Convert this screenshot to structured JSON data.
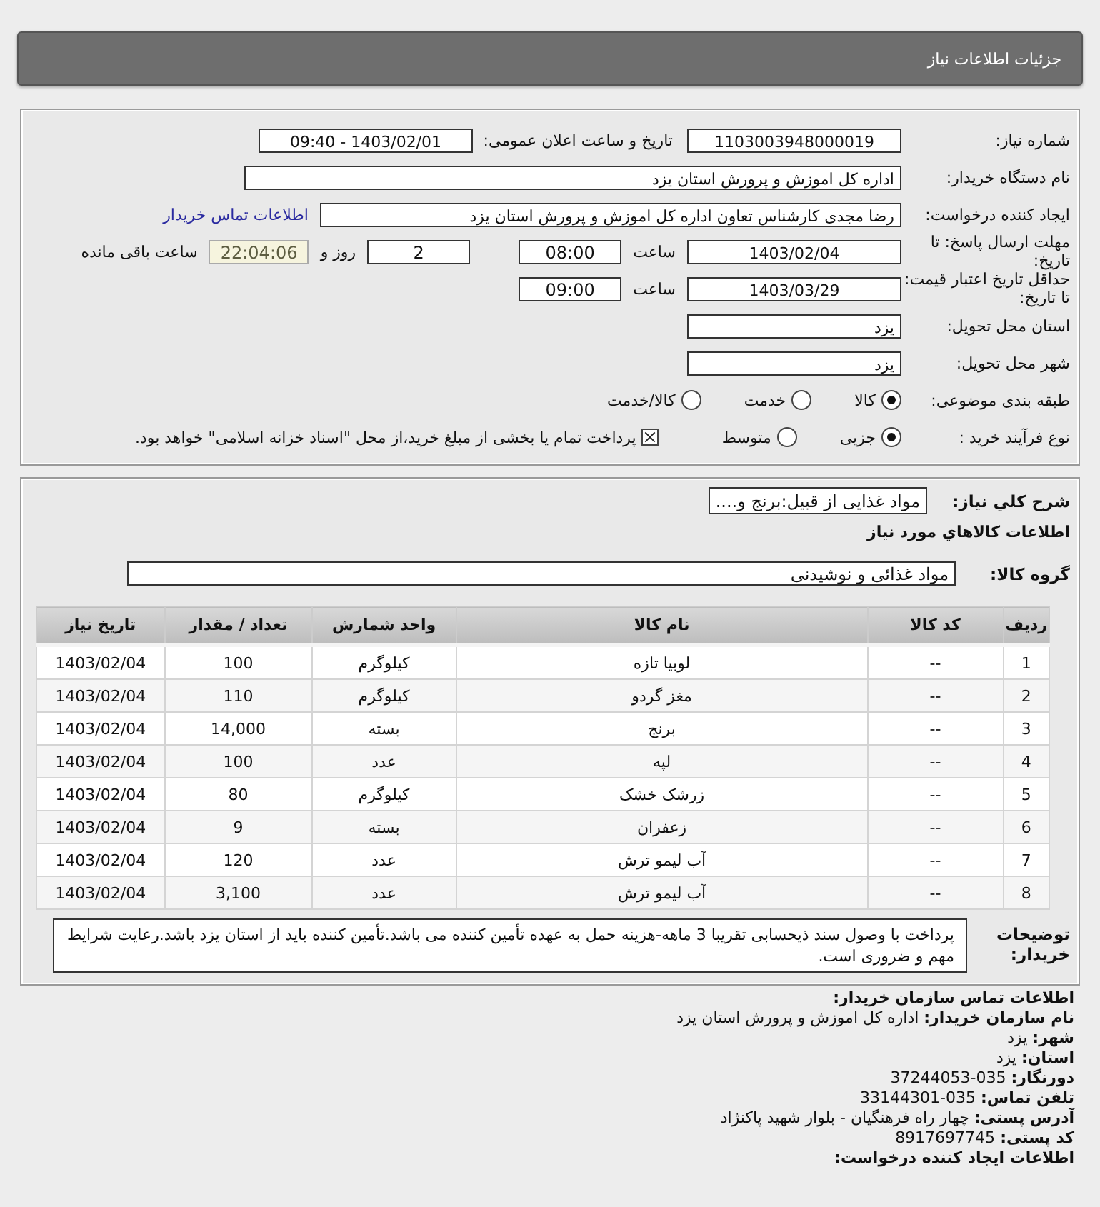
{
  "header": {
    "title": "جزئیات اطلاعات نیاز"
  },
  "details": [
    {
      "label": "شماره نیاز:",
      "items": [
        {
          "kind": "field",
          "value": "1103003948000019"
        },
        {
          "kind": "text",
          "value": "تاریخ و ساعت اعلان عمومی:"
        },
        {
          "kind": "field",
          "value": "1403/02/01 - 09:40"
        }
      ]
    },
    {
      "label": "نام دستگاه خریدار:",
      "items": [
        {
          "kind": "wide",
          "value": "اداره کل اموزش و پرورش استان یزد"
        }
      ]
    },
    {
      "label": "ایجاد کننده درخواست:",
      "items": [
        {
          "kind": "long",
          "value": "رضا مجدی کارشناس تعاون اداره کل اموزش و پرورش استان یزد"
        },
        {
          "kind": "link",
          "value": "اطلاعات تماس خریدار"
        }
      ]
    },
    {
      "label": "مهلت ارسال پاسخ: تا تاریخ:",
      "items": [
        {
          "kind": "field",
          "value": "1403/02/04"
        },
        {
          "kind": "text",
          "value": "ساعت"
        },
        {
          "kind": "short",
          "value": "08:00"
        },
        {
          "kind": "short",
          "value": "2"
        },
        {
          "kind": "text",
          "value": "روز و"
        },
        {
          "kind": "timer",
          "value": "22:04:06"
        },
        {
          "kind": "text",
          "value": "ساعت باقی مانده"
        }
      ]
    },
    {
      "label": "حداقل تاریخ اعتبار قیمت: تا تاریخ:",
      "items": [
        {
          "kind": "field",
          "value": "1403/03/29"
        },
        {
          "kind": "text",
          "value": "ساعت"
        },
        {
          "kind": "short",
          "value": "09:00"
        }
      ]
    },
    {
      "label": "استان محل تحویل:",
      "items": [
        {
          "kind": "field",
          "value": "یزد"
        }
      ]
    },
    {
      "label": "شهر محل تحویل:",
      "items": [
        {
          "kind": "field",
          "value": "یزد"
        }
      ]
    },
    {
      "label": "طبقه بندی موضوعی:",
      "items": [
        {
          "kind": "radio",
          "value": "کالا",
          "selected": true
        },
        {
          "kind": "radio",
          "value": "خدمت",
          "selected": false
        },
        {
          "kind": "radio",
          "value": "کالا/خدمت",
          "selected": false
        }
      ]
    },
    {
      "label": "نوع فرآیند خرید :",
      "items": [
        {
          "kind": "radio",
          "value": "جزیی",
          "selected": true
        },
        {
          "kind": "radio",
          "value": "متوسط",
          "selected": false
        },
        {
          "kind": "checkbox",
          "value": "پرداخت تمام یا بخشی از مبلغ خرید،از محل \"اسناد خزانه اسلامی\" خواهد بود.",
          "checked": true
        }
      ]
    }
  ],
  "need": {
    "summary_label": "شرح کلي نياز:",
    "summary": "مواد غذایی از قبیل:برنج و....",
    "goods_heading": "اطلاعات کالاهاي مورد نياز",
    "group_label": "گروه کالا:",
    "group": "مواد غذائی و نوشیدنی"
  },
  "table": {
    "columns": [
      "ردیف",
      "کد کالا",
      "نام کالا",
      "واحد شمارش",
      "تعداد / مقدار",
      "تاریخ نیاز"
    ],
    "rows": [
      [
        "1",
        "--",
        "لوبیا تازه",
        "کیلوگرم",
        "100",
        "1403/02/04"
      ],
      [
        "2",
        "--",
        "مغز گردو",
        "کیلوگرم",
        "110",
        "1403/02/04"
      ],
      [
        "3",
        "--",
        "برنج",
        "بسته",
        "14,000",
        "1403/02/04"
      ],
      [
        "4",
        "--",
        "لپه",
        "عدد",
        "100",
        "1403/02/04"
      ],
      [
        "5",
        "--",
        "زرشک خشک",
        "کیلوگرم",
        "80",
        "1403/02/04"
      ],
      [
        "6",
        "--",
        "زعفران",
        "بسته",
        "9",
        "1403/02/04"
      ],
      [
        "7",
        "--",
        "آب لیمو ترش",
        "عدد",
        "120",
        "1403/02/04"
      ],
      [
        "8",
        "--",
        "آب لیمو ترش",
        "عدد",
        "3,100",
        "1403/02/04"
      ]
    ]
  },
  "buyer_notes": {
    "label": "توضیحات خریدار:",
    "text": "پرداخت با وصول سند ذیحسابی تقریبا 3 ماهه-هزینه حمل به عهده تأمین کننده می باشد.تأمین کننده باید از استان یزد باشد.رعایت شرایط مهم و ضروری است."
  },
  "contact": {
    "title": "اطلاعات تماس سازمان خریدار:",
    "lines": [
      {
        "label": "نام سازمان خریدار:",
        "value": "اداره کل اموزش و پرورش استان یزد"
      },
      {
        "label": "شهر:",
        "value": "یزد"
      },
      {
        "label": "استان:",
        "value": "یزد"
      },
      {
        "label": "دورنگار:",
        "value": "035-37244053"
      },
      {
        "label": "تلفن تماس:",
        "value": "035-33144301"
      },
      {
        "label": "آدرس پستی:",
        "value": "چهار راه فرهنگیان - بلوار شهید پاکنژاد"
      },
      {
        "label": "کد پستی:",
        "value": "8917697745"
      }
    ],
    "next_title": "اطلاعات ایجاد کننده درخواست:"
  }
}
